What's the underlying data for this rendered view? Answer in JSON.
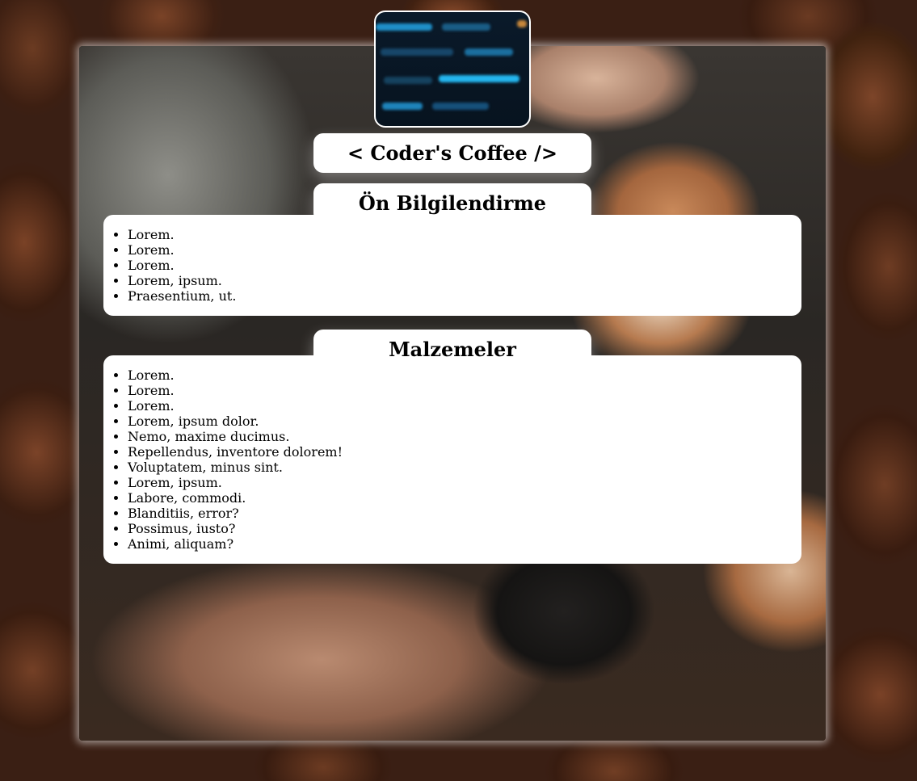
{
  "header": {
    "logo_icon": "code-screen-image",
    "title": "< Coder's Coffee />"
  },
  "sections": [
    {
      "heading": "Ön Bilgilendirme",
      "items": [
        "Lorem.",
        "Lorem.",
        "Lorem.",
        "Lorem, ipsum.",
        "Praesentium, ut."
      ]
    },
    {
      "heading": "Malzemeler",
      "items": [
        "Lorem.",
        "Lorem.",
        "Lorem.",
        "Lorem, ipsum dolor.",
        "Nemo, maxime ducimus.",
        "Repellendus, inventore dolorem!",
        "Voluptatem, minus sint.",
        "Lorem, ipsum.",
        "Labore, commodi.",
        "Blanditiis, error?",
        "Possimus, iusto?",
        "Animi, aliquam?"
      ]
    }
  ],
  "colors": {
    "page_background": "#3a1f14",
    "panel_background": "#ffffff",
    "text": "#000000",
    "logo_accent": "#1fa6e0"
  }
}
